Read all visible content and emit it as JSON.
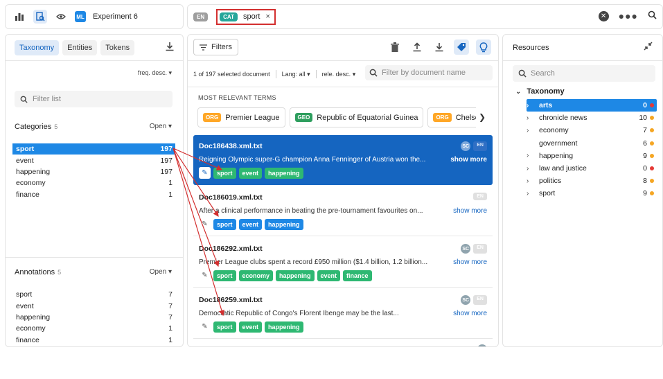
{
  "topbar": {
    "experiment_badge": "ML",
    "experiment_title": "Experiment 6",
    "language_badge": "EN",
    "active_filter": {
      "badge": "CAT",
      "label": "sport",
      "remove": "×"
    }
  },
  "left": {
    "tabs": [
      "Taxonomy",
      "Entities",
      "Tokens"
    ],
    "sort_label": "freq. desc.",
    "filter_placeholder": "Filter list",
    "categories": {
      "title": "Categories",
      "count": "5",
      "open_label": "Open",
      "items": [
        {
          "label": "sport",
          "value": "197"
        },
        {
          "label": "event",
          "value": "197"
        },
        {
          "label": "happening",
          "value": "197"
        },
        {
          "label": "economy",
          "value": "1"
        },
        {
          "label": "finance",
          "value": "1"
        }
      ]
    },
    "annotations": {
      "title": "Annotations",
      "count": "5",
      "open_label": "Open",
      "items": [
        {
          "label": "sport",
          "value": "7"
        },
        {
          "label": "event",
          "value": "7"
        },
        {
          "label": "happening",
          "value": "7"
        },
        {
          "label": "economy",
          "value": "1"
        },
        {
          "label": "finance",
          "value": "1"
        }
      ]
    }
  },
  "mid": {
    "filters_label": "Filters",
    "doc_count": "1 of 197 selected document",
    "lang_label": "Lang: all",
    "sort_label": "rele. desc.",
    "search_placeholder": "Filter by document name",
    "relevant_title": "MOST RELEVANT TERMS",
    "terms": [
      {
        "badge": "ORG",
        "label": "Premier League",
        "kind": "org"
      },
      {
        "badge": "GEO",
        "label": "Republic of Equatorial Guinea",
        "kind": "geo"
      },
      {
        "badge": "ORG",
        "label": "Chelsea",
        "kind": "org"
      }
    ],
    "show_more": "show more",
    "documents": [
      {
        "name": "Doc186438.xml.txt",
        "text": "Reigning Olympic super-G champion Anna Fenninger of Austria won the...",
        "badges": [
          "SC",
          "EN"
        ],
        "tags": [
          "sport",
          "event",
          "happening"
        ],
        "tag_colors": [
          "green",
          "green",
          "green"
        ]
      },
      {
        "name": "Doc186019.xml.txt",
        "text": "After a clinical performance in beating the pre-tournament favourites on...",
        "badges": [
          "EN"
        ],
        "tags": [
          "sport",
          "event",
          "happening"
        ],
        "tag_colors": [
          "blue",
          "blue",
          "blue"
        ]
      },
      {
        "name": "Doc186292.xml.txt",
        "text": "Premier League clubs spent a record £950 million ($1.4 billion, 1.2 billion...",
        "badges": [
          "SC",
          "EN"
        ],
        "tags": [
          "sport",
          "economy",
          "happening",
          "event",
          "finance"
        ],
        "tag_colors": [
          "green",
          "green",
          "green",
          "green",
          "green"
        ]
      },
      {
        "name": "Doc186259.xml.txt",
        "text": "Democratic Republic of Congo's Florent Ibenge may be the last...",
        "badges": [
          "SC",
          "EN"
        ],
        "tags": [
          "sport",
          "event",
          "happening"
        ],
        "tag_colors": [
          "green",
          "green",
          "green"
        ]
      }
    ]
  },
  "right": {
    "title": "Resources",
    "search_placeholder": "Search",
    "taxonomy_root": "Taxonomy",
    "items": [
      {
        "label": "arts",
        "value": "0",
        "dot": "#e53935",
        "chevron": true
      },
      {
        "label": "chronicle news",
        "value": "10",
        "dot": "#f5a623",
        "chevron": true
      },
      {
        "label": "economy",
        "value": "7",
        "dot": "#f5a623",
        "chevron": true
      },
      {
        "label": "government",
        "value": "6",
        "dot": "#f5a623",
        "chevron": false
      },
      {
        "label": "happening",
        "value": "9",
        "dot": "#f5a623",
        "chevron": true
      },
      {
        "label": "law and justice",
        "value": "0",
        "dot": "#e53935",
        "chevron": true
      },
      {
        "label": "politics",
        "value": "8",
        "dot": "#f5a623",
        "chevron": true
      },
      {
        "label": "sport",
        "value": "9",
        "dot": "#f5a623",
        "chevron": true
      }
    ]
  },
  "colors": {
    "accent": "#1e88e5",
    "selected_doc": "#1565c0",
    "annotation_arrow": "#d32f2f",
    "tag_green": "#2eb872",
    "tag_blue": "#1e88e5"
  }
}
